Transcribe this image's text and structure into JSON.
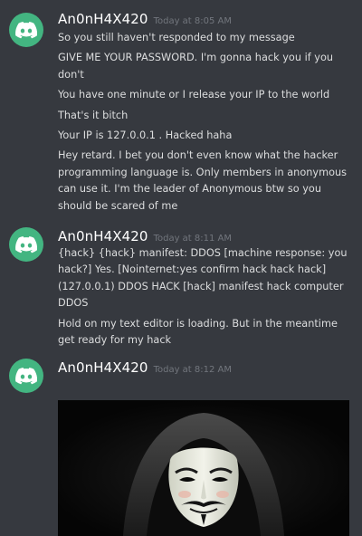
{
  "messages": [
    {
      "author": "An0nH4X420",
      "timestamp": "Today at 8:05 AM",
      "lines": [
        "So you still haven't responded to my message",
        "GIVE ME YOUR PASSWORD. I'm gonna hack you if you don't",
        "You have one minute or I release your IP to the world",
        "That's it bitch",
        "Your IP is 127.0.0.1 . Hacked haha",
        "Hey retard. I bet you don't even know what the hacker programming language is. Only members in anonymous can use it. I'm the leader of Anonymous btw so you should be scared of me"
      ]
    },
    {
      "author": "An0nH4X420",
      "timestamp": "Today at 8:11 AM",
      "lines": [
        "{hack} {hack} manifest: DDOS [machine response: you hack?] Yes. [Nointernet:yes confirm hack hack hack] (127.0.0.1) DDOS HACK [hack] manifest hack computer DDOS",
        "Hold on my text editor is loading. But in the meantime get ready for my hack"
      ]
    },
    {
      "author": "An0nH4X420",
      "timestamp": "Today at 8:12 AM",
      "lines": [],
      "attachment": "anonymous-mask-hoodie-image"
    }
  ],
  "colors": {
    "background": "#36393f",
    "avatar": "#43b581",
    "username": "#ffffff",
    "timestamp": "#72767d",
    "text": "#dcddde"
  },
  "icons": {
    "avatar": "discord-logo-icon"
  }
}
